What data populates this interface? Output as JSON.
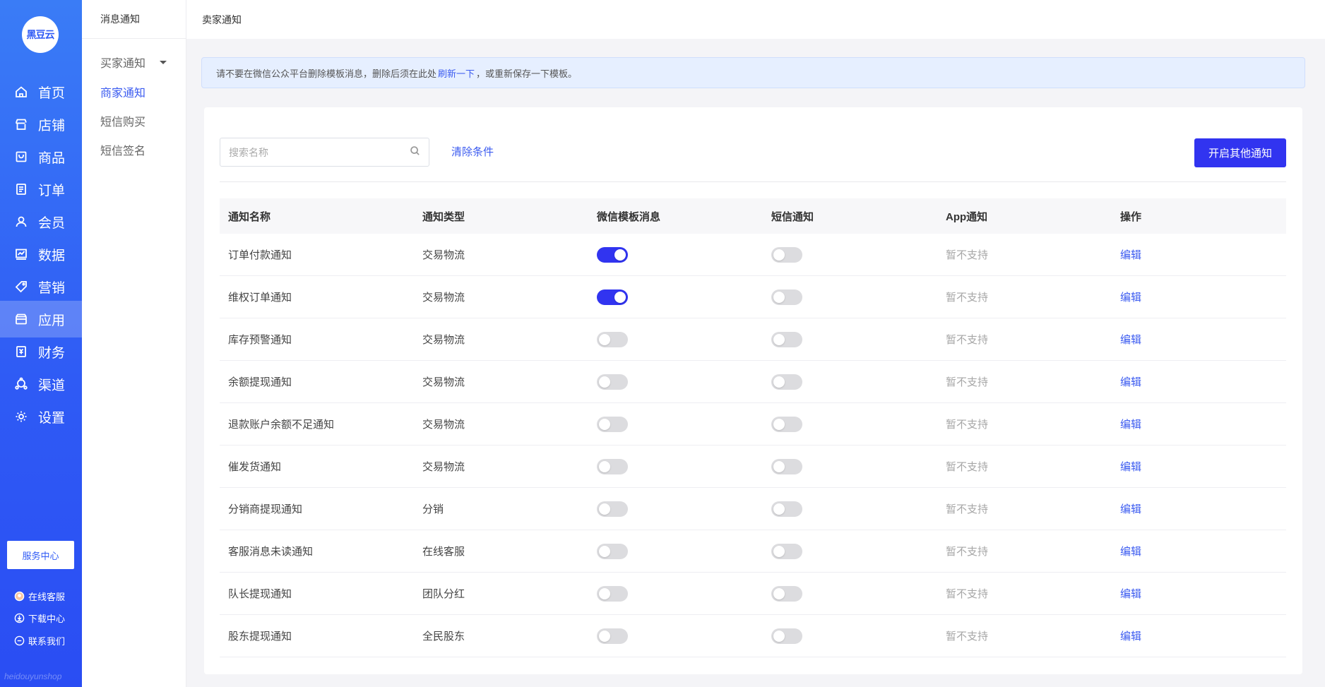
{
  "brand": {
    "logo_text": "黑豆云",
    "watermark": "heidouyunshop"
  },
  "main_nav": [
    {
      "label": "首页",
      "icon": "home-icon",
      "active": false
    },
    {
      "label": "店铺",
      "icon": "store-icon",
      "active": false
    },
    {
      "label": "商品",
      "icon": "goods-icon",
      "active": false
    },
    {
      "label": "订单",
      "icon": "order-icon",
      "active": false
    },
    {
      "label": "会员",
      "icon": "member-icon",
      "active": false
    },
    {
      "label": "数据",
      "icon": "data-icon",
      "active": false
    },
    {
      "label": "营销",
      "icon": "tag-icon",
      "active": false
    },
    {
      "label": "应用",
      "icon": "app-icon",
      "active": true
    },
    {
      "label": "财务",
      "icon": "finance-icon",
      "active": false
    },
    {
      "label": "渠道",
      "icon": "channel-icon",
      "active": false
    },
    {
      "label": "设置",
      "icon": "gear-icon",
      "active": false
    }
  ],
  "footer": {
    "service_button": "服务中心",
    "online_service": "在线客服",
    "download_center": "下载中心",
    "contact_us": "联系我们"
  },
  "subnav": {
    "title": "消息通知",
    "items": [
      {
        "label": "买家通知",
        "active": false,
        "has_caret": true
      },
      {
        "label": "商家通知",
        "active": true,
        "has_caret": false
      },
      {
        "label": "短信购买",
        "active": false,
        "has_caret": false
      },
      {
        "label": "短信签名",
        "active": false,
        "has_caret": false
      }
    ]
  },
  "topbar": {
    "title": "卖家通知"
  },
  "notice": {
    "before": "请不要在微信公众平台删除模板消息，删除后须在此处",
    "link": "刷新一下",
    "after": "，或重新保存一下模板。"
  },
  "toolbar": {
    "search_placeholder": "搜索名称",
    "clear_label": "清除条件",
    "open_other_label": "开启其他通知"
  },
  "table": {
    "headers": [
      "通知名称",
      "通知类型",
      "微信模板消息",
      "短信通知",
      "App通知",
      "操作"
    ],
    "rows": [
      {
        "name": "订单付款通知",
        "type": "交易物流",
        "wechat": true,
        "sms": false,
        "app": "暂不支持",
        "action": "编辑"
      },
      {
        "name": "维权订单通知",
        "type": "交易物流",
        "wechat": true,
        "sms": false,
        "app": "暂不支持",
        "action": "编辑"
      },
      {
        "name": "库存预警通知",
        "type": "交易物流",
        "wechat": false,
        "sms": false,
        "app": "暂不支持",
        "action": "编辑"
      },
      {
        "name": "余额提现通知",
        "type": "交易物流",
        "wechat": false,
        "sms": false,
        "app": "暂不支持",
        "action": "编辑"
      },
      {
        "name": "退款账户余额不足通知",
        "type": "交易物流",
        "wechat": false,
        "sms": false,
        "app": "暂不支持",
        "action": "编辑"
      },
      {
        "name": "催发货通知",
        "type": "交易物流",
        "wechat": false,
        "sms": false,
        "app": "暂不支持",
        "action": "编辑"
      },
      {
        "name": "分销商提现通知",
        "type": "分销",
        "wechat": false,
        "sms": false,
        "app": "暂不支持",
        "action": "编辑"
      },
      {
        "name": "客服消息未读通知",
        "type": "在线客服",
        "wechat": false,
        "sms": false,
        "app": "暂不支持",
        "action": "编辑"
      },
      {
        "name": "队长提现通知",
        "type": "团队分红",
        "wechat": false,
        "sms": false,
        "app": "暂不支持",
        "action": "编辑"
      },
      {
        "name": "股东提现通知",
        "type": "全民股东",
        "wechat": false,
        "sms": false,
        "app": "暂不支持",
        "action": "编辑"
      }
    ]
  },
  "colors": {
    "brand_blue": "#2f5bf5",
    "accent": "#3134f0",
    "link": "#3b5bf0"
  }
}
